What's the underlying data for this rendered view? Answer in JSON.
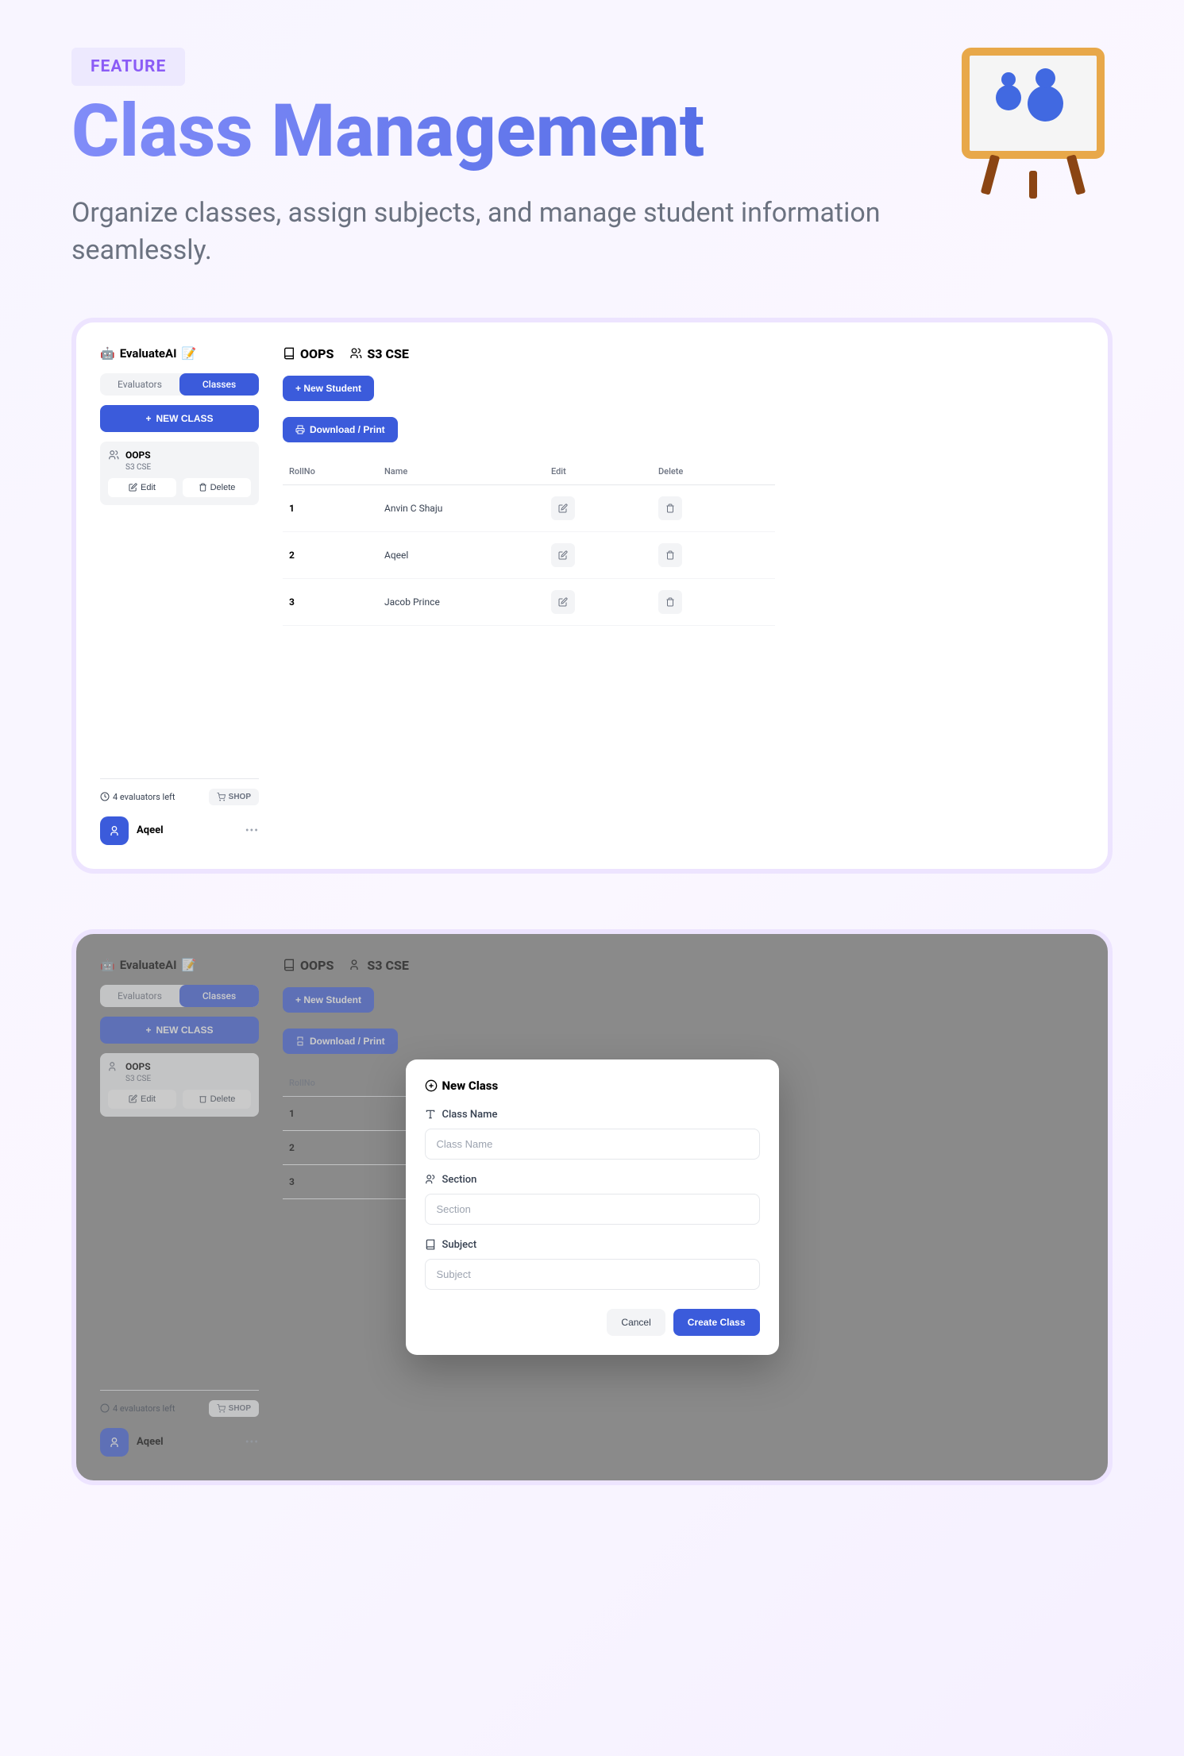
{
  "hero": {
    "badge": "FEATURE",
    "title": "Class Management",
    "subtitle": "Organize classes, assign subjects, and manage student information seamlessly."
  },
  "app": {
    "logo_text": "EvaluateAI",
    "tabs": {
      "evaluators": "Evaluators",
      "classes": "Classes"
    },
    "new_class_btn": "NEW CLASS",
    "class_card": {
      "name": "OOPS",
      "section": "S3 CSE",
      "edit": "Edit",
      "delete": "Delete"
    },
    "evaluators_left": "4 evaluators left",
    "shop": "SHOP",
    "username": "Aqeel",
    "header": {
      "subject": "OOPS",
      "section": "S3 CSE"
    },
    "new_student_btn": "+ New Student",
    "download_btn": "Download / Print",
    "table": {
      "headers": {
        "roll": "RollNo",
        "name": "Name",
        "edit": "Edit",
        "delete": "Delete"
      },
      "rows": [
        {
          "roll": "1",
          "name": "Anvin C Shaju"
        },
        {
          "roll": "2",
          "name": "Aqeel"
        },
        {
          "roll": "3",
          "name": "Jacob Prince"
        }
      ]
    }
  },
  "modal": {
    "title": "New Class",
    "fields": {
      "class_name": {
        "label": "Class Name",
        "placeholder": "Class Name"
      },
      "section": {
        "label": "Section",
        "placeholder": "Section"
      },
      "subject": {
        "label": "Subject",
        "placeholder": "Subject"
      }
    },
    "cancel": "Cancel",
    "create": "Create Class"
  }
}
